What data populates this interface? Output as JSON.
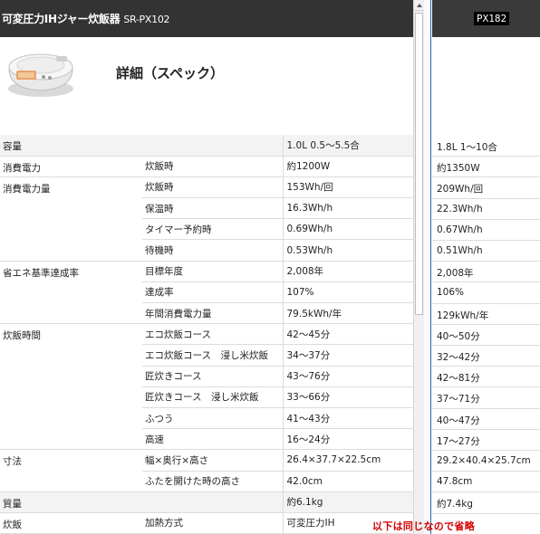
{
  "left": {
    "title": "可変圧力IHジャー炊飯器",
    "model": "SR-PX102",
    "heading": "詳細（スペック）",
    "rows": [
      {
        "cat": "容量",
        "sub": "",
        "val": "1.0L 0.5～5.5合"
      },
      {
        "cat": "消費電力",
        "sub": "炊飯時",
        "val": "約1200W"
      },
      {
        "cat": "消費電力量",
        "sub": "炊飯時",
        "val": "153Wh/回"
      },
      {
        "cat": "",
        "sub": "保温時",
        "val": "16.3Wh/h"
      },
      {
        "cat": "",
        "sub": "タイマー予約時",
        "val": "0.69Wh/h"
      },
      {
        "cat": "",
        "sub": "待機時",
        "val": "0.53Wh/h"
      },
      {
        "cat": "省エネ基準達成率",
        "sub": "目標年度",
        "val": "2,008年"
      },
      {
        "cat": "",
        "sub": "達成率",
        "val": "107%"
      },
      {
        "cat": "",
        "sub": "年間消費電力量",
        "val": "79.5kWh/年"
      },
      {
        "cat": "炊飯時間",
        "sub": "エコ炊飯コース",
        "val": "42～45分"
      },
      {
        "cat": "",
        "sub": "エコ炊飯コース　浸し米炊飯",
        "val": "34～37分"
      },
      {
        "cat": "",
        "sub": "匠炊きコース",
        "val": "43～76分"
      },
      {
        "cat": "",
        "sub": "匠炊きコース　浸し米炊飯",
        "val": "33～66分"
      },
      {
        "cat": "",
        "sub": "ふつう",
        "val": "41～43分"
      },
      {
        "cat": "",
        "sub": "高速",
        "val": "16～24分"
      },
      {
        "cat": "寸法",
        "sub": "幅×奥行×高さ",
        "val": "26.4×37.7×22.5cm"
      },
      {
        "cat": "",
        "sub": "ふたを開けた時の高さ",
        "val": "42.0cm"
      },
      {
        "cat": "質量",
        "sub": "",
        "val": "約6.1kg"
      },
      {
        "cat": "炊飯",
        "sub": "加熱方式",
        "val": "可変圧力IH"
      }
    ]
  },
  "right": {
    "model": "PX182",
    "values": [
      "1.8L 1～10合",
      "約1350W",
      "209Wh/回",
      "22.3Wh/h",
      "0.67Wh/h",
      "0.51Wh/h",
      "2,008年",
      "106%",
      "129kWh/年",
      "40～50分",
      "32～42分",
      "42～81分",
      "37～71分",
      "40～47分",
      "17～27分",
      "29.2×40.4×25.7cm",
      "47.8cm",
      "約7.4kg"
    ]
  },
  "note": "以下は同じなので省略"
}
